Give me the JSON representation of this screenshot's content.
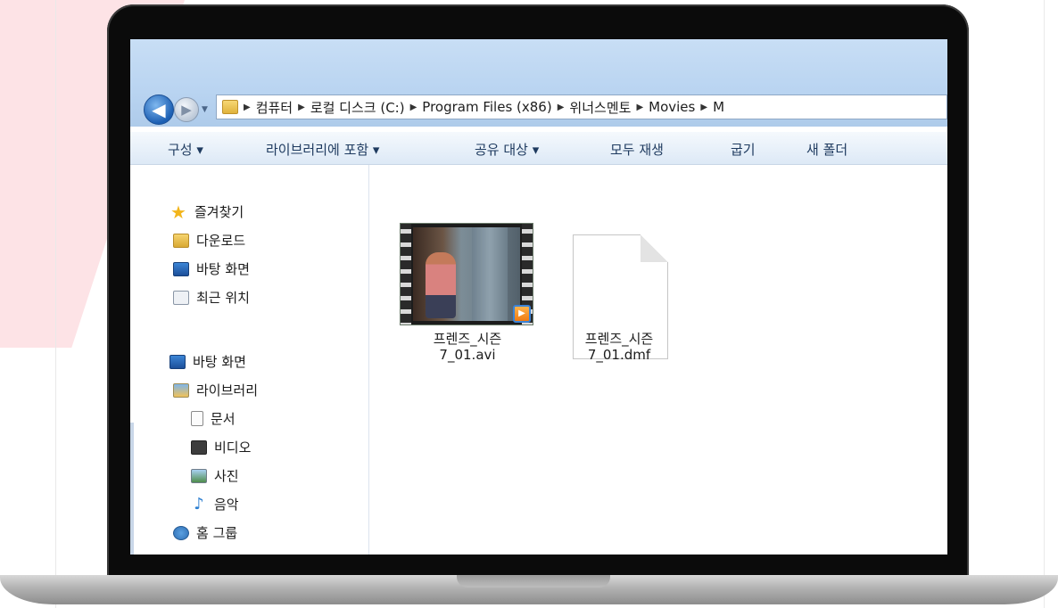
{
  "address_bar": {
    "crumbs": [
      "컴퓨터",
      "로컬 디스크 (C:)",
      "Program Files (x86)",
      "위너스멘토",
      "Movies",
      "M"
    ]
  },
  "toolbar": {
    "organize": "구성 ▾",
    "include_in_library": "라이브러리에 포함 ▾",
    "share_with": "공유 대상 ▾",
    "play_all": "모두 재생",
    "burn": "굽기",
    "new_folder": "새 폴더"
  },
  "nav_pane": {
    "favorites": "즐겨찾기",
    "downloads": "다운로드",
    "desktop_fav": "바탕 화면",
    "recent": "최근 위치",
    "desktop": "바탕 화면",
    "libraries": "라이브러리",
    "documents": "문서",
    "videos": "비디오",
    "pictures": "사진",
    "music": "음악",
    "homegroup": "홈 그룹"
  },
  "files": [
    {
      "name_line1": "프렌즈_시즌",
      "name_line2": "7_01.avi",
      "icon": "video-thumbnail"
    },
    {
      "name_line1": "프렌즈_시즌",
      "name_line2": "7_01.dmf",
      "icon": "blank-document-icon"
    }
  ],
  "colors": {
    "accent_bg": "#fde3e6",
    "explorer_titlebar": "#c8def5",
    "toolbar_text": "#1e3a5f"
  }
}
